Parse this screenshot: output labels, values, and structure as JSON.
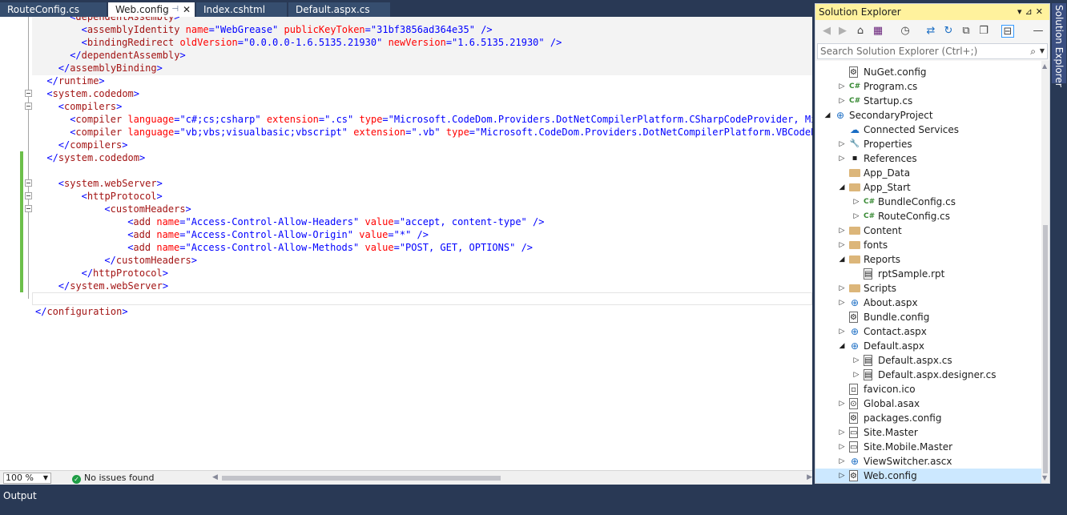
{
  "tabs": [
    {
      "label": "RouteConfig.cs",
      "active": false
    },
    {
      "label": "Web.config",
      "active": true
    },
    {
      "label": "Index.cshtml",
      "active": false
    },
    {
      "label": "Default.aspx.cs",
      "active": false
    }
  ],
  "editor": {
    "lines": [
      {
        "segments": [
          [
            "b",
            "<"
          ],
          [
            "t",
            "dependentAssembly"
          ],
          [
            "b",
            ">"
          ]
        ]
      },
      {
        "segments": [
          [
            "b",
            "<"
          ],
          [
            "t",
            "assemblyIdentity"
          ],
          [
            "k",
            " "
          ],
          [
            "a",
            "name"
          ],
          [
            "b",
            "=\""
          ],
          [
            "v",
            "WebGrease"
          ],
          [
            "b",
            "\""
          ],
          [
            "k",
            " "
          ],
          [
            "a",
            "publicKeyToken"
          ],
          [
            "b",
            "=\""
          ],
          [
            "v",
            "31bf3856ad364e35"
          ],
          [
            "b",
            "\""
          ],
          [
            "k",
            " "
          ],
          [
            "b",
            "/>"
          ]
        ]
      },
      {
        "segments": [
          [
            "b",
            "<"
          ],
          [
            "t",
            "bindingRedirect"
          ],
          [
            "k",
            " "
          ],
          [
            "a",
            "oldVersion"
          ],
          [
            "b",
            "=\""
          ],
          [
            "v",
            "0.0.0.0-1.6.5135.21930"
          ],
          [
            "b",
            "\""
          ],
          [
            "k",
            " "
          ],
          [
            "a",
            "newVersion"
          ],
          [
            "b",
            "=\""
          ],
          [
            "v",
            "1.6.5135.21930"
          ],
          [
            "b",
            "\""
          ],
          [
            "k",
            " "
          ],
          [
            "b",
            "/>"
          ]
        ]
      },
      {
        "segments": [
          [
            "b",
            "</"
          ],
          [
            "t",
            "dependentAssembly"
          ],
          [
            "b",
            ">"
          ]
        ]
      },
      {
        "segments": [
          [
            "b",
            "</"
          ],
          [
            "t",
            "assemblyBinding"
          ],
          [
            "b",
            ">"
          ]
        ]
      },
      {
        "segments": [
          [
            "b",
            "</"
          ],
          [
            "t",
            "runtime"
          ],
          [
            "b",
            ">"
          ]
        ]
      },
      {
        "segments": [
          [
            "b",
            "<"
          ],
          [
            "t",
            "system.codedom"
          ],
          [
            "b",
            ">"
          ]
        ]
      },
      {
        "segments": [
          [
            "b",
            "<"
          ],
          [
            "t",
            "compilers"
          ],
          [
            "b",
            ">"
          ]
        ]
      },
      {
        "segments": [
          [
            "b",
            "<"
          ],
          [
            "t",
            "compiler"
          ],
          [
            "k",
            " "
          ],
          [
            "a",
            "language"
          ],
          [
            "b",
            "=\""
          ],
          [
            "v",
            "c#;cs;csharp"
          ],
          [
            "b",
            "\""
          ],
          [
            "k",
            " "
          ],
          [
            "a",
            "extension"
          ],
          [
            "b",
            "=\""
          ],
          [
            "v",
            ".cs"
          ],
          [
            "b",
            "\""
          ],
          [
            "k",
            " "
          ],
          [
            "a",
            "type"
          ],
          [
            "b",
            "=\""
          ],
          [
            "v",
            "Microsoft.CodeDom.Providers.DotNetCompilerPlatform.CSharpCodeProvider, Micros"
          ]
        ]
      },
      {
        "segments": [
          [
            "b",
            "<"
          ],
          [
            "t",
            "compiler"
          ],
          [
            "k",
            " "
          ],
          [
            "a",
            "language"
          ],
          [
            "b",
            "=\""
          ],
          [
            "v",
            "vb;vbs;visualbasic;vbscript"
          ],
          [
            "b",
            "\""
          ],
          [
            "k",
            " "
          ],
          [
            "a",
            "extension"
          ],
          [
            "b",
            "=\""
          ],
          [
            "v",
            ".vb"
          ],
          [
            "b",
            "\""
          ],
          [
            "k",
            " "
          ],
          [
            "a",
            "type"
          ],
          [
            "b",
            "=\""
          ],
          [
            "v",
            "Microsoft.CodeDom.Providers.DotNetCompilerPlatform.VBCodeProvi"
          ]
        ]
      },
      {
        "segments": [
          [
            "b",
            "</"
          ],
          [
            "t",
            "compilers"
          ],
          [
            "b",
            ">"
          ]
        ]
      },
      {
        "segments": [
          [
            "b",
            "</"
          ],
          [
            "t",
            "system.codedom"
          ],
          [
            "b",
            ">"
          ]
        ]
      },
      {
        "segments": []
      },
      {
        "segments": [
          [
            "b",
            "<"
          ],
          [
            "t",
            "system.webServer"
          ],
          [
            "b",
            ">"
          ]
        ]
      },
      {
        "segments": [
          [
            "b",
            "<"
          ],
          [
            "t",
            "httpProtocol"
          ],
          [
            "b",
            ">"
          ]
        ]
      },
      {
        "segments": [
          [
            "b",
            "<"
          ],
          [
            "t",
            "customHeaders"
          ],
          [
            "b",
            ">"
          ]
        ]
      },
      {
        "segments": [
          [
            "b",
            "<"
          ],
          [
            "t",
            "add"
          ],
          [
            "k",
            " "
          ],
          [
            "a",
            "name"
          ],
          [
            "b",
            "=\""
          ],
          [
            "v",
            "Access-Control-Allow-Headers"
          ],
          [
            "b",
            "\""
          ],
          [
            "k",
            " "
          ],
          [
            "a",
            "value"
          ],
          [
            "b",
            "=\""
          ],
          [
            "v",
            "accept, content-type"
          ],
          [
            "b",
            "\""
          ],
          [
            "k",
            " "
          ],
          [
            "b",
            "/>"
          ]
        ]
      },
      {
        "segments": [
          [
            "b",
            "<"
          ],
          [
            "t",
            "add"
          ],
          [
            "k",
            " "
          ],
          [
            "a",
            "name"
          ],
          [
            "b",
            "=\""
          ],
          [
            "v",
            "Access-Control-Allow-Origin"
          ],
          [
            "b",
            "\""
          ],
          [
            "k",
            " "
          ],
          [
            "a",
            "value"
          ],
          [
            "b",
            "=\""
          ],
          [
            "v",
            "*"
          ],
          [
            "b",
            "\""
          ],
          [
            "k",
            " "
          ],
          [
            "b",
            "/>"
          ]
        ]
      },
      {
        "segments": [
          [
            "b",
            "<"
          ],
          [
            "t",
            "add"
          ],
          [
            "k",
            " "
          ],
          [
            "a",
            "name"
          ],
          [
            "b",
            "=\""
          ],
          [
            "v",
            "Access-Control-Allow-Methods"
          ],
          [
            "b",
            "\""
          ],
          [
            "k",
            " "
          ],
          [
            "a",
            "value"
          ],
          [
            "b",
            "=\""
          ],
          [
            "v",
            "POST, GET, OPTIONS"
          ],
          [
            "b",
            "\""
          ],
          [
            "k",
            " "
          ],
          [
            "b",
            "/>"
          ]
        ]
      },
      {
        "segments": [
          [
            "b",
            "</"
          ],
          [
            "t",
            "customHeaders"
          ],
          [
            "b",
            ">"
          ]
        ]
      },
      {
        "segments": [
          [
            "b",
            "</"
          ],
          [
            "t",
            "httpProtocol"
          ],
          [
            "b",
            ">"
          ]
        ]
      },
      {
        "segments": [
          [
            "b",
            "</"
          ],
          [
            "t",
            "system.webServer"
          ],
          [
            "b",
            ">"
          ]
        ]
      },
      {
        "segments": []
      },
      {
        "segments": [
          [
            "b",
            "</"
          ],
          [
            "t",
            "configuration"
          ],
          [
            "b",
            ">"
          ]
        ]
      }
    ],
    "zoom": "100 %",
    "issues": "No issues found"
  },
  "solution_explorer": {
    "title": "Solution Explorer",
    "search_placeholder": "Search Solution Explorer (Ctrl+;)",
    "items": [
      {
        "label": "NuGet.config",
        "icon": "config-file-icon",
        "expander": ""
      },
      {
        "label": "Program.cs",
        "icon": "csharp-file-icon",
        "expander": "collapsed"
      },
      {
        "label": "Startup.cs",
        "icon": "csharp-file-icon",
        "expander": "collapsed"
      },
      {
        "label": "SecondaryProject",
        "icon": "web-project-icon",
        "expander": "expanded"
      },
      {
        "label": "Connected Services",
        "icon": "connected-services-icon",
        "expander": ""
      },
      {
        "label": "Properties",
        "icon": "wrench-icon",
        "expander": "collapsed"
      },
      {
        "label": "References",
        "icon": "references-icon",
        "expander": "collapsed"
      },
      {
        "label": "App_Data",
        "icon": "folder-icon",
        "expander": ""
      },
      {
        "label": "App_Start",
        "icon": "folder-open-icon",
        "expander": "expanded"
      },
      {
        "label": "BundleConfig.cs",
        "icon": "csharp-file-icon",
        "expander": "collapsed"
      },
      {
        "label": "RouteConfig.cs",
        "icon": "csharp-file-icon",
        "expander": "collapsed"
      },
      {
        "label": "Content",
        "icon": "folder-icon",
        "expander": "collapsed"
      },
      {
        "label": "fonts",
        "icon": "folder-icon",
        "expander": "collapsed"
      },
      {
        "label": "Reports",
        "icon": "folder-open-icon",
        "expander": "expanded"
      },
      {
        "label": "rptSample.rpt",
        "icon": "report-file-icon",
        "expander": ""
      },
      {
        "label": "Scripts",
        "icon": "folder-icon",
        "expander": "collapsed"
      },
      {
        "label": "About.aspx",
        "icon": "web-file-icon",
        "expander": "collapsed"
      },
      {
        "label": "Bundle.config",
        "icon": "config-file-icon",
        "expander": ""
      },
      {
        "label": "Contact.aspx",
        "icon": "web-file-icon",
        "expander": "collapsed"
      },
      {
        "label": "Default.aspx",
        "icon": "web-file-icon",
        "expander": "expanded"
      },
      {
        "label": "Default.aspx.cs",
        "icon": "code-file-icon",
        "expander": "collapsed"
      },
      {
        "label": "Default.aspx.designer.cs",
        "icon": "code-file-icon",
        "expander": "collapsed"
      },
      {
        "label": "favicon.ico",
        "icon": "image-file-icon",
        "expander": ""
      },
      {
        "label": "Global.asax",
        "icon": "global-file-icon",
        "expander": "collapsed"
      },
      {
        "label": "packages.config",
        "icon": "config-file-icon",
        "expander": ""
      },
      {
        "label": "Site.Master",
        "icon": "master-file-icon",
        "expander": "collapsed"
      },
      {
        "label": "Site.Mobile.Master",
        "icon": "master-file-icon",
        "expander": "collapsed"
      },
      {
        "label": "ViewSwitcher.ascx",
        "icon": "control-file-icon",
        "expander": "collapsed"
      },
      {
        "label": "Web.config",
        "icon": "config-file-icon",
        "expander": "collapsed",
        "selected": true
      }
    ]
  },
  "side_tab": "Solution Explorer",
  "output_tab": "Output",
  "colors": {
    "chrome": "#293955",
    "title_highlight": "#fff29d",
    "selection": "#cce8ff",
    "change_margin": "#6cbf4a"
  }
}
